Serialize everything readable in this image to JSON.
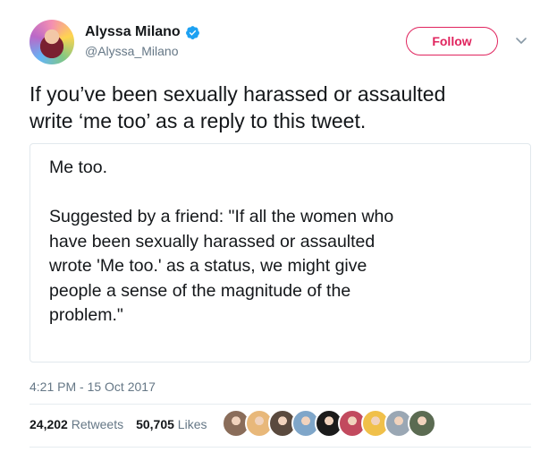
{
  "author": {
    "name": "Alyssa Milano",
    "handle": "@Alyssa_Milano",
    "verified_icon": "verified-badge-icon"
  },
  "header": {
    "follow_label": "Follow",
    "caret_icon": "chevron-down-icon"
  },
  "tweet": {
    "text": "If you’ve been sexually harassed or assaulted\nwrite ‘me too’ as a reply to this tweet.",
    "quoted_text": "Me too.\n\nSuggested by a friend: \"If all the women who\nhave been sexually harassed or assaulted\nwrote 'Me too.' as a status, we might give\npeople a sense of the magnitude of the\nproblem.\"",
    "timestamp": "4:21 PM - 15 Oct 2017"
  },
  "stats": {
    "retweets_count": "24,202",
    "retweets_label": "Retweets",
    "likes_count": "50,705",
    "likes_label": "Likes"
  },
  "colors": {
    "accent": "#e0245e",
    "verified": "#1da1f2",
    "muted": "#657786",
    "text": "#14171a",
    "border": "#e1e8ed"
  },
  "liker_faces": [
    {
      "color": "#8a6d5a"
    },
    {
      "color": "#e8b87a"
    },
    {
      "color": "#5a4a3e"
    },
    {
      "color": "#7fa6c9"
    },
    {
      "color": "#1b1b1b"
    },
    {
      "color": "#c24a5e"
    },
    {
      "color": "#f0c04a"
    },
    {
      "color": "#9aa7b4"
    },
    {
      "color": "#5b6b52"
    }
  ]
}
